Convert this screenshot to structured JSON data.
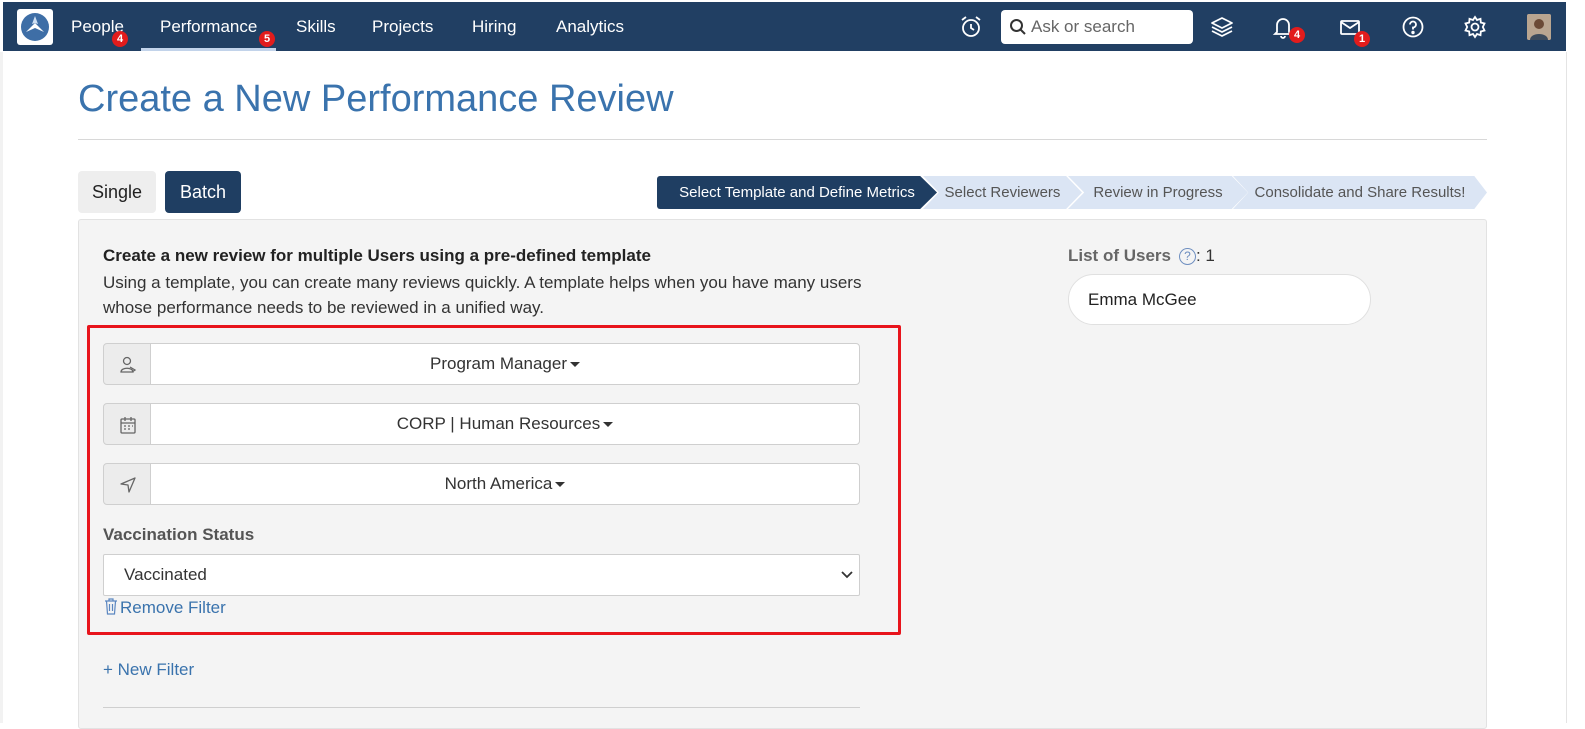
{
  "nav": {
    "items": [
      {
        "label": "People",
        "badge": "4"
      },
      {
        "label": "Performance",
        "badge": "5",
        "active": true
      },
      {
        "label": "Skills"
      },
      {
        "label": "Projects"
      },
      {
        "label": "Hiring"
      },
      {
        "label": "Analytics"
      }
    ],
    "search_placeholder": "Ask or search",
    "notifications_badge": "4",
    "messages_badge": "1",
    "icons": [
      "alarm-clock-icon",
      "search-icon",
      "layers-icon",
      "bell-icon",
      "mail-icon",
      "help-icon",
      "gear-icon",
      "avatar"
    ]
  },
  "page": {
    "title": "Create a New Performance Review"
  },
  "mode": {
    "single_label": "Single",
    "batch_label": "Batch",
    "selected": "Batch"
  },
  "wizard": {
    "steps": [
      "Select Template and Define Metrics",
      "Select Reviewers",
      "Review in Progress",
      "Consolidate and Share Results!"
    ],
    "current": 1
  },
  "form": {
    "intro_title": "Create a new review for multiple Users using a pre-defined template",
    "intro_text": "Using a template, you can create many reviews quickly. A template helps when you have many users whose performance needs to be reviewed in a unified way.",
    "role_value": "Program Manager",
    "department_value": "CORP | Human Resources",
    "location_value": "North America",
    "vaccination_label": "Vaccination Status",
    "vaccination_value": "Vaccinated",
    "remove_filter_label": "Remove Filter",
    "new_filter_label": "+ New Filter"
  },
  "users": {
    "label": "List of Users",
    "help": "?",
    "count": ": 1",
    "list": [
      "Emma McGee"
    ]
  },
  "colors": {
    "nav_bg": "#213f63",
    "accent": "#3a73ad",
    "badge": "#e21c1c",
    "highlight": "#e8141c"
  }
}
